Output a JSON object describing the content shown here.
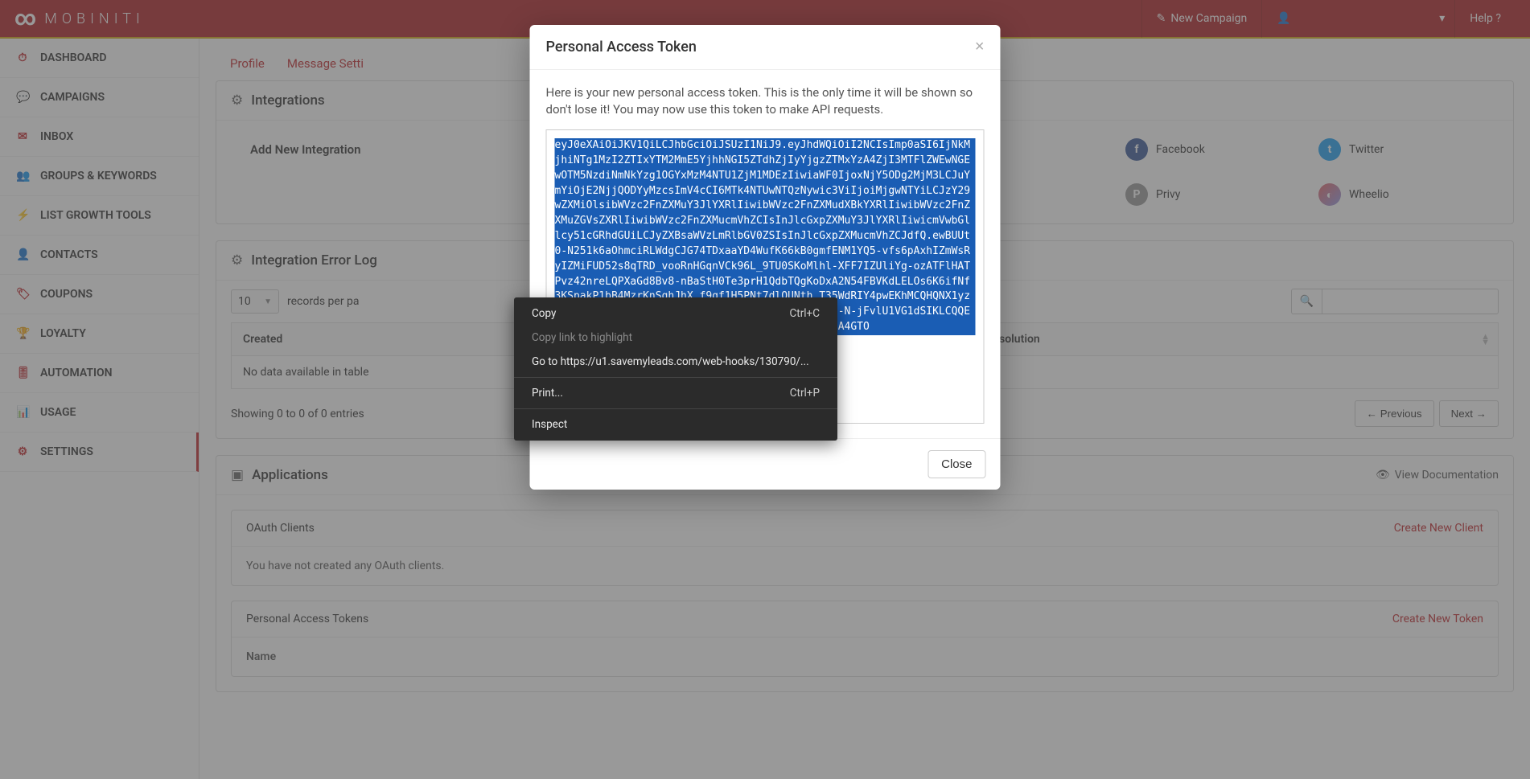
{
  "brand": "MOBINITI",
  "topbar": {
    "new_campaign": "New Campaign",
    "help": "Help ?"
  },
  "sidebar": {
    "items": [
      {
        "label": "DASHBOARD"
      },
      {
        "label": "CAMPAIGNS"
      },
      {
        "label": "INBOX"
      },
      {
        "label": "GROUPS & KEYWORDS"
      },
      {
        "label": "LIST GROWTH TOOLS"
      },
      {
        "label": "CONTACTS"
      },
      {
        "label": "COUPONS"
      },
      {
        "label": "LOYALTY"
      },
      {
        "label": "AUTOMATION"
      },
      {
        "label": "USAGE"
      },
      {
        "label": "SETTINGS"
      }
    ]
  },
  "tabs": {
    "profile": "Profile",
    "message_settings": "Message Setti"
  },
  "integrations": {
    "title": "Integrations",
    "add_label": "Add New Integration",
    "items": [
      {
        "label": "Facebook"
      },
      {
        "label": "Twitter"
      },
      {
        "label": "Privy"
      },
      {
        "label": "Wheelio"
      }
    ]
  },
  "error_log": {
    "title": "Integration Error Log",
    "records_value": "10",
    "records_label": "records per pa",
    "col_created": "Created",
    "col_resolution": "Possible Resolution",
    "empty": "No data available in table",
    "showing": "Showing 0 to 0 of 0 entries",
    "prev": "← Previous",
    "next": "Next →"
  },
  "applications": {
    "title": "Applications",
    "view_docs": "View Documentation",
    "oauth_title": "OAuth Clients",
    "oauth_create": "Create New Client",
    "oauth_empty": "You have not created any OAuth clients.",
    "pat_title": "Personal Access Tokens",
    "pat_create": "Create New Token",
    "pat_name": "Name"
  },
  "modal": {
    "title": "Personal Access Token",
    "message": "Here is your new personal access token. This is the only time it will be shown so don't lose it! You may now use this token to make API requests.",
    "token": "eyJ0eXAiOiJKV1QiLCJhbGciOiJSUzI1NiJ9.eyJhdWQiOiI2NCIsImp0aSI6IjNkMjhiNTg1MzI2ZTIxYTM2MmE5YjhhNGI5ZTdhZjIyYjgzZTMxYzA4ZjI3MTFlZWEwNGEwOTM5NzdiNmNkYzg1OGYxMzM4NTU1ZjM1MDEzIiwiaWF0IjoxNjY5ODg2MjM3LCJuYmYiOjE2NjjQODYyMzcsImV4cCI6MTk4NTUwNTQzNywic3ViIjoiMjgwNTYiLCJzY29wZXMiOlsibWVzc2FnZXMuY3JlYXRlIiwibWVzc2FnZXMudXBkYXRlIiwibWVzc2FnZXMuZGVsZXRlIiwibWVzc2FnZXMucmVhZCIsInJlcGxpZXMuY3JlYXRlIiwicmVwbGllcy51cGRhdGUiLCJyZXBsaWVzLmRlbGV0ZSIsInJlcGxpZXMucmVhZCJdfQ.ewBUUt0-N251k6aOhmciRLWdgCJG74TDxaaYD4WufK66kB0gmfENM1YQ5-vfs6pAxhIZmWsRyIZMiFUD52s8qTRD_vooRnHGqnVCk96L_9TU0SKoMlhl-XFF7IZUliYg-ozATFlHATPvz42nreLQPXaGd8Bv8-nBaStH0Te3prH1QdbTQgKoDxA2N54FBVKdLELOs6K6ifNf3KSpakP1bB4MzrKnSqhJhX_f9qf1H5PNt7dlQUNth_T35WdRIY4pwEKhMCQHQNX1yzbRq6KtXA5ICckBTH1ia17gHArK9449vXsGLYl-rv_e-oj-N-jFvlU1VG1dSIKLCQQEnmu0Wzd311Y_L5qB0jB6fddD4tOyYQT0mpQBYL1Qf-M48A4GTO",
    "close": "Close"
  },
  "context_menu": {
    "copy": "Copy",
    "copy_sc": "Ctrl+C",
    "copy_link": "Copy link to highlight",
    "goto": "Go to https://u1.savemyleads.com/web-hooks/130790/...",
    "print": "Print...",
    "print_sc": "Ctrl+P",
    "inspect": "Inspect"
  }
}
